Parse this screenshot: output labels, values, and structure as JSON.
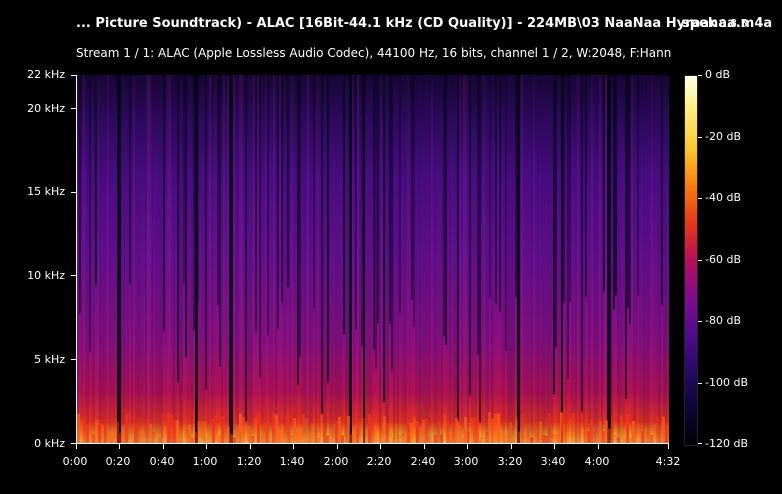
{
  "header": {
    "title": "... Picture Soundtrack) - ALAC [16Bit-44.1 kHz (CD Quality)] - 224MB\\03 NaaNaa Hyraanaa.m4a",
    "app_name": "spek",
    "app_version": "0.8.5",
    "stream_info": "Stream 1 / 1: ALAC (Apple Lossless Audio Codec), 44100 Hz, 16 bits, channel 1 / 2, W:2048, F:Hann"
  },
  "axes": {
    "y_ticks": [
      "0 kHz",
      "5 kHz",
      "10 kHz",
      "15 kHz",
      "20 kHz",
      "22 kHz"
    ],
    "x_ticks": [
      "0:00",
      "0:20",
      "0:40",
      "1:00",
      "1:20",
      "1:40",
      "2:00",
      "2:20",
      "2:40",
      "3:00",
      "3:20",
      "3:40",
      "4:00",
      "4:32"
    ],
    "colorbar_ticks": [
      "0 dB",
      "-20 dB",
      "-40 dB",
      "-60 dB",
      "-80 dB",
      "-100 dB",
      "-120 dB"
    ]
  },
  "colors": {
    "background": "#000000",
    "axis": "#ffffff",
    "spectrum_low": "#000008",
    "spectrum_mid": "#8a0c8a",
    "spectrum_high": "#fdc52c",
    "spectrum_peak": "#ffffe8"
  }
}
